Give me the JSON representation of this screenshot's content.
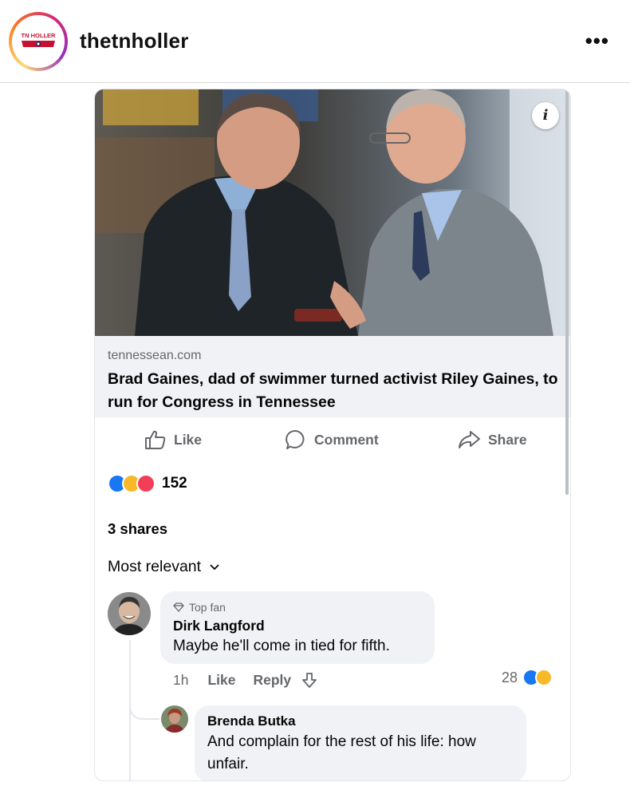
{
  "header": {
    "username": "thetnholler",
    "logo_text": "TN HOLLER",
    "more_icon": "more-dots-icon"
  },
  "post": {
    "link": {
      "domain": "tennessean.com",
      "title": "Brad Gaines, dad of swimmer turned activist Riley Gaines, to run for Congress in Tennessee"
    },
    "info_label": "i",
    "actions": {
      "like": "Like",
      "comment": "Comment",
      "share": "Share"
    },
    "reactions": {
      "types": [
        "like",
        "haha",
        "love"
      ],
      "count": "152"
    },
    "shares": "3 shares",
    "sort_label": "Most relevant"
  },
  "comments": [
    {
      "badge": "Top fan",
      "author": "Dirk Langford",
      "text": "Maybe he'll come in tied for fifth.",
      "time": "1h",
      "like_label": "Like",
      "reply_label": "Reply",
      "reaction_count": "28",
      "reaction_types": [
        "like",
        "haha"
      ]
    }
  ],
  "replies": [
    {
      "author": "Brenda Butka",
      "text": "And complain for the rest of his life: how unfair."
    }
  ],
  "colors": {
    "fb_blue": "#1877f2",
    "gray_text": "#65676b",
    "bubble_bg": "#f0f2f5",
    "haha_yellow": "#f7b928",
    "love_red": "#f33e58"
  }
}
